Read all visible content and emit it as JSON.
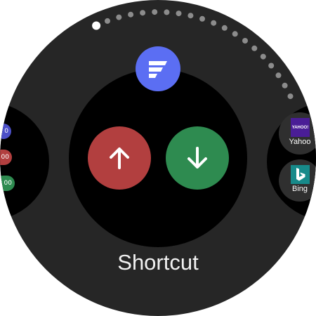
{
  "screen": {
    "title": "Shortcut",
    "page_indicator": {
      "total": 20,
      "current": 1
    }
  },
  "app": {
    "icon": "flow-logo-icon",
    "accent_color": "#5b6ef3"
  },
  "actions": [
    {
      "name": "arrow-up-button",
      "icon": "arrow-up-icon",
      "color": "#b23f3f"
    },
    {
      "name": "arrow-down-button",
      "icon": "arrow-down-icon",
      "color": "#2e8b50"
    }
  ],
  "left_panel": {
    "badges": [
      {
        "text": "0",
        "color": "#4c50c8"
      },
      {
        "text": "00",
        "color": "#b23f3f"
      },
      {
        "text": "00",
        "color": "#2e8b50"
      }
    ]
  },
  "right_panel": {
    "apps": [
      {
        "label": "Yahoo",
        "tile_text": "YAHOO!",
        "color": "#4a1d96"
      },
      {
        "label": "Bing",
        "icon": "bing-logo-icon",
        "color": "#178a8a"
      }
    ]
  },
  "colors": {
    "background": "#262626",
    "panel": "#000000",
    "dot": "#8c8c8c",
    "dot_active": "#ffffff"
  }
}
